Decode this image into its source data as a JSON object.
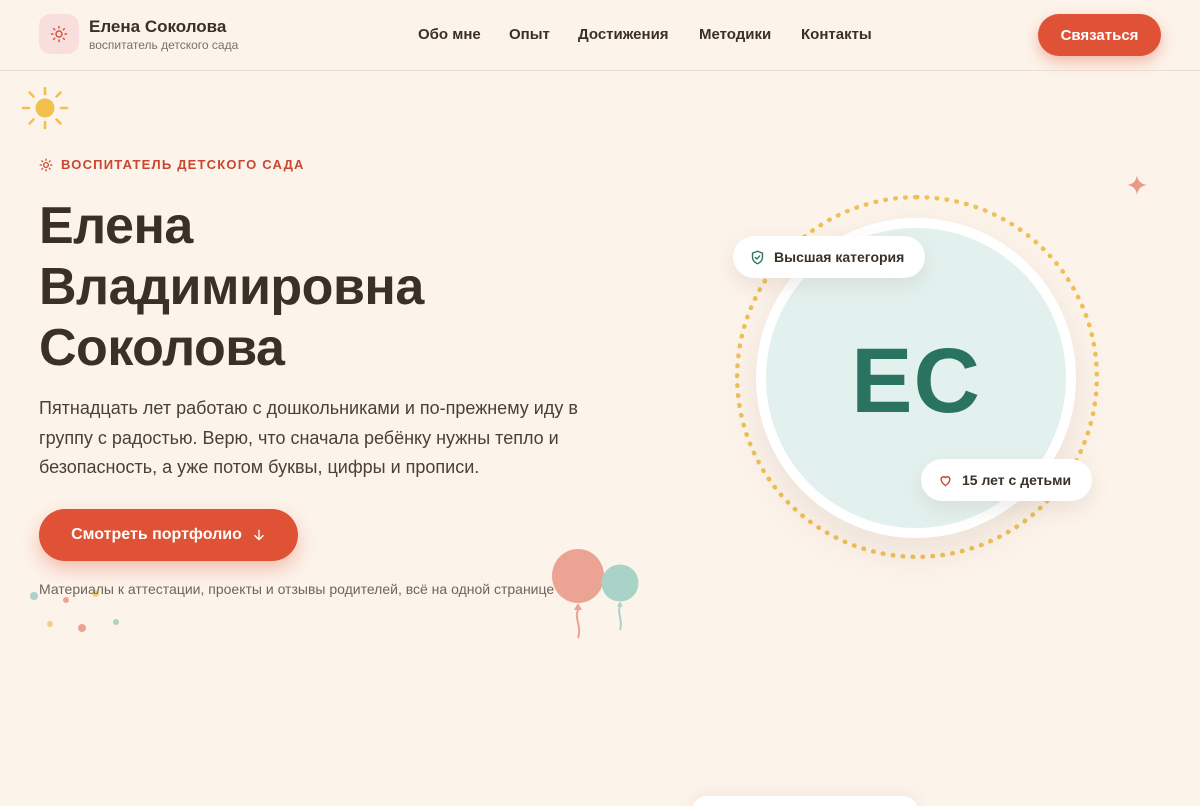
{
  "header": {
    "brand_name": "Елена Соколова",
    "brand_subtitle": "воспитатель детского сада",
    "logo_icon": "sun-icon",
    "nav": [
      {
        "label": "Обо мне"
      },
      {
        "label": "Опыт"
      },
      {
        "label": "Достижения"
      },
      {
        "label": "Методики"
      },
      {
        "label": "Контакты"
      }
    ],
    "cta_label": "Связаться"
  },
  "hero": {
    "eyebrow": "ВОСПИТАТЕЛЬ ДЕТСКОГО САДА",
    "title_lines": [
      "Елена",
      "Владимировна",
      "Соколова"
    ],
    "text": "Пятнадцать лет работаю с дошкольниками и по-прежнему иду в группу с радостью. Верю, что сначала ребёнку нужны тепло и безопасность, а уже потом буквы, цифры и прописи.",
    "button_label": "Смотреть портфолио",
    "note": "Материалы к аттестации, проекты и отзывы родителей, всё на одной странице"
  },
  "avatar": {
    "initials": "ЕС",
    "badge_category": "Высшая категория",
    "badge_years": "15 лет с детьми"
  },
  "colors": {
    "background": "#fcf3ea",
    "accent": "#df5236",
    "avatar_bg": "#e3f1ee",
    "initials": "#2a7361",
    "ring": "#eec055"
  },
  "icons": [
    "sun-icon",
    "shield-check-icon",
    "heart-icon",
    "arrow-down-icon",
    "sparkle-icon",
    "balloon-icon"
  ]
}
